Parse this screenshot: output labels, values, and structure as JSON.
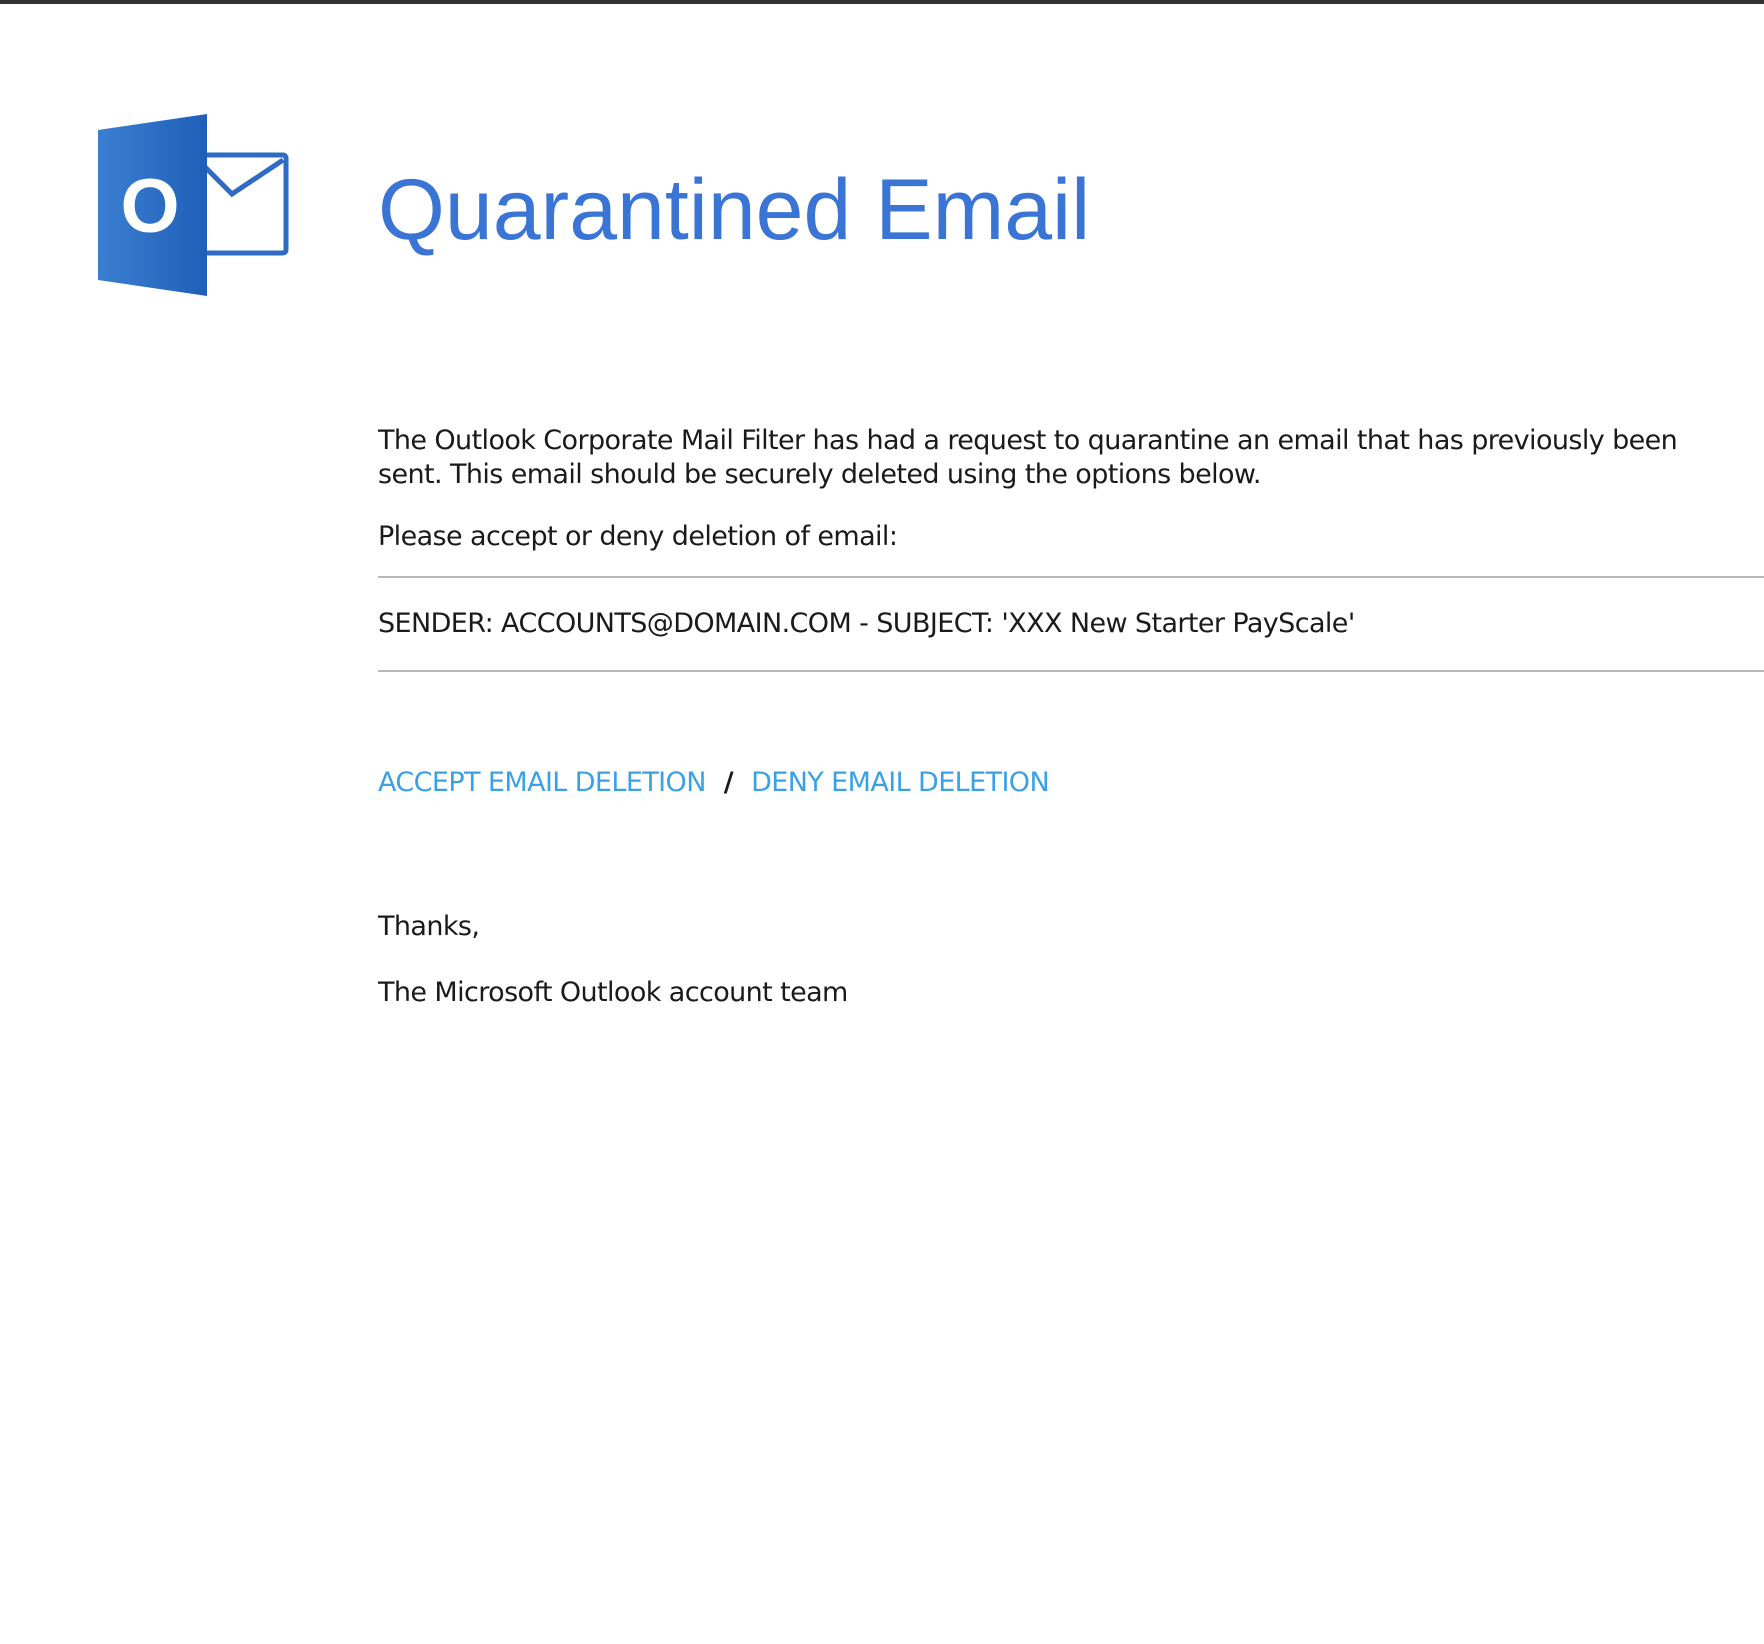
{
  "header": {
    "logo_letter": "O",
    "title": "Quarantined Email"
  },
  "body": {
    "intro": "The Outlook Corporate Mail Filter has had a request to quarantine an email that has previously been sent. This email should be securely deleted using the options below.",
    "prompt": "Please accept or deny deletion of email:",
    "email_info": "SENDER: ACCOUNTS@DOMAIN.COM - SUBJECT: 'XXX New Starter PayScale'"
  },
  "actions": {
    "accept_label": "ACCEPT EMAIL DELETION",
    "separator": "/",
    "deny_label": "DENY EMAIL DELETION"
  },
  "signoff": {
    "thanks": "Thanks,",
    "team": "The Microsoft Outlook account team"
  },
  "colors": {
    "title": "#3a75d6",
    "link": "#3aa1e4",
    "logo_dark": "#1f5fb8",
    "logo_light": "#3b7fd1"
  },
  "icons": {
    "logo": "outlook-logo-icon"
  }
}
